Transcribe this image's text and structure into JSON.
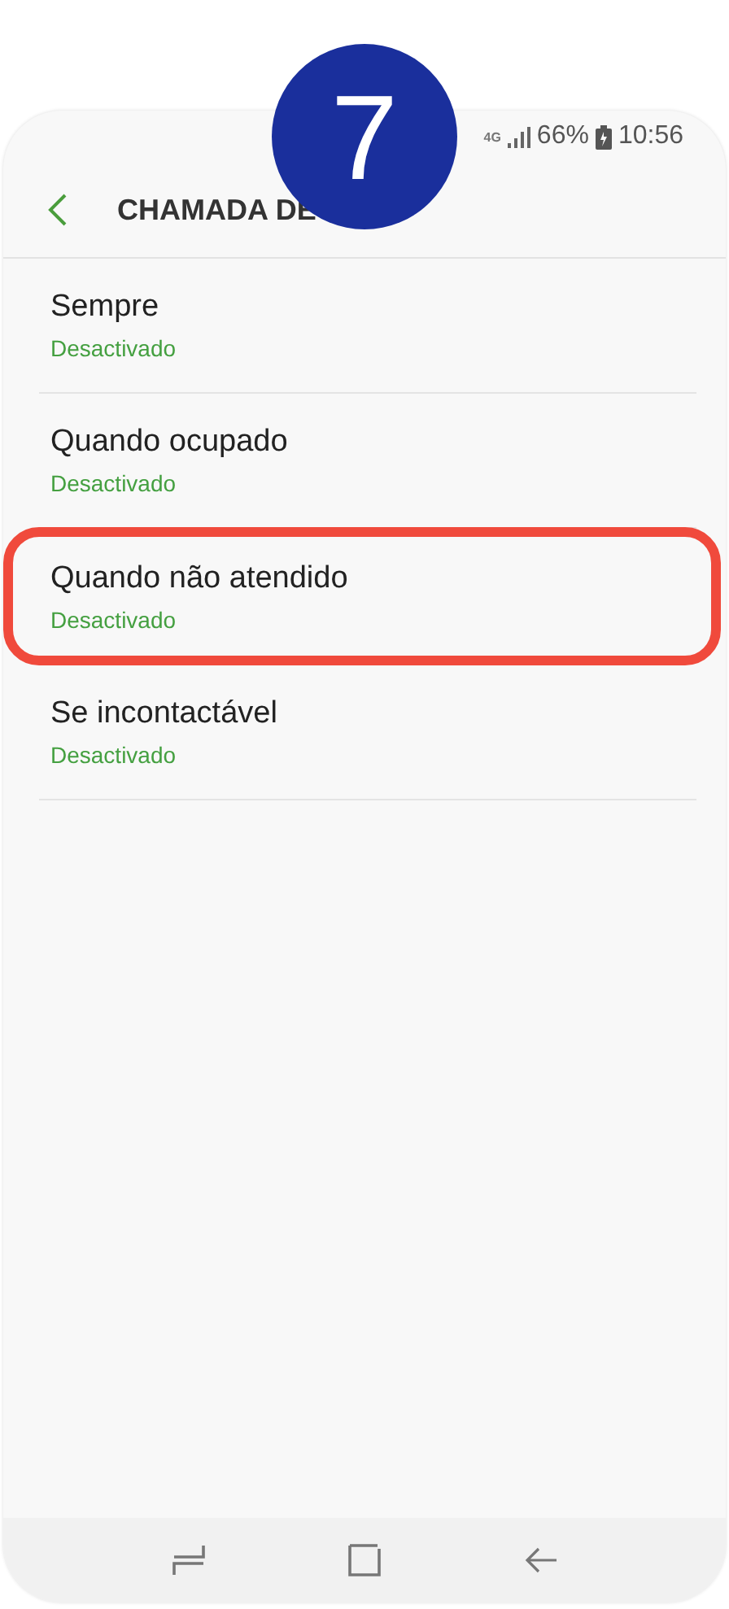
{
  "badge": "7",
  "status_bar": {
    "network": "4G",
    "battery": "66%",
    "time": "10:56"
  },
  "header": {
    "title": "CHAMADA DE"
  },
  "items": [
    {
      "title": "Sempre",
      "status": "Desactivado",
      "highlighted": false
    },
    {
      "title": "Quando ocupado",
      "status": "Desactivado",
      "highlighted": false
    },
    {
      "title": "Quando não atendido",
      "status": "Desactivado",
      "highlighted": true
    },
    {
      "title": "Se incontactável",
      "status": "Desactivado",
      "highlighted": false
    }
  ]
}
